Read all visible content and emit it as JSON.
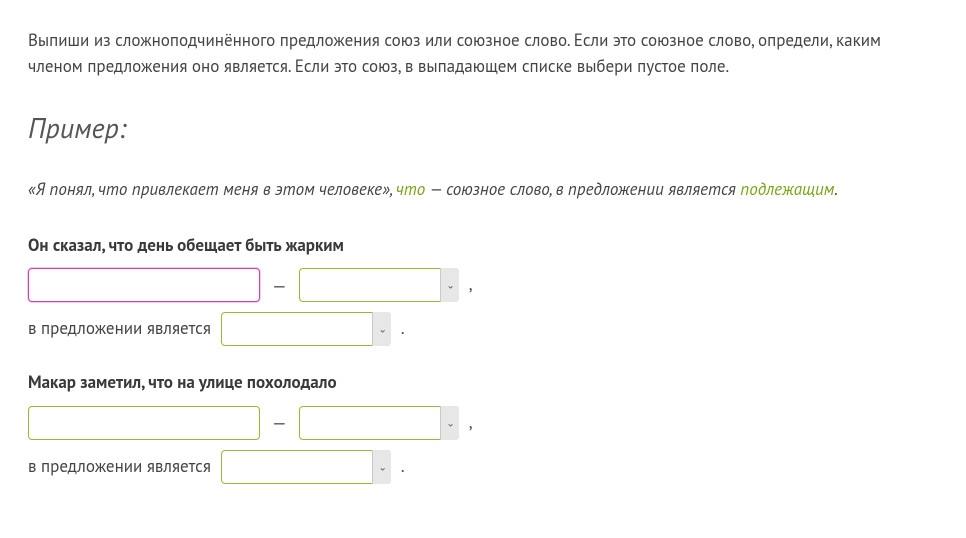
{
  "instruction": "Выпиши из сложноподчинённого предложения союз или союзное слово. Если это союзное слово, определи, каким членом предложения оно является. Если это союз, в выпадающем списке выбери пустое поле.",
  "example_heading": "Пример:",
  "example": {
    "sentence_prefix": "«Я понял, что привлекает меня в этом человеке», ",
    "answer_word": "что",
    "mid": " — союзное слово, в предложении является ",
    "role": "подлежащим",
    "suffix": "."
  },
  "tasks": [
    {
      "sentence": "Он сказал, что день обещает быть жарким",
      "input_value": "",
      "input_focused": true,
      "dash": "—",
      "select1_value": "",
      "comma": ",",
      "line2_prefix": "в предложении является",
      "select2_value": "",
      "period": "."
    },
    {
      "sentence": "Макар заметил, что на улице похолодало",
      "input_value": "",
      "input_focused": false,
      "dash": "—",
      "select1_value": "",
      "comma": ",",
      "line2_prefix": "в предложении является",
      "select2_value": "",
      "period": "."
    }
  ]
}
